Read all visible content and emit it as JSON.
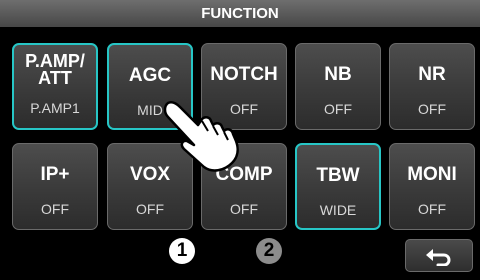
{
  "title": "FUNCTION",
  "buttons": [
    {
      "id": "pamp-att",
      "name": "P.AMP/\nATT",
      "value": "P.AMP1",
      "active": true
    },
    {
      "id": "agc",
      "name": "AGC",
      "value": "MID",
      "active": true
    },
    {
      "id": "notch",
      "name": "NOTCH",
      "value": "OFF",
      "active": false
    },
    {
      "id": "nb",
      "name": "NB",
      "value": "OFF",
      "active": false
    },
    {
      "id": "nr",
      "name": "NR",
      "value": "OFF",
      "active": false
    },
    {
      "id": "ip-plus",
      "name": "IP+",
      "value": "OFF",
      "active": false
    },
    {
      "id": "vox",
      "name": "VOX",
      "value": "OFF",
      "active": false
    },
    {
      "id": "comp",
      "name": "COMP",
      "value": "OFF",
      "active": false
    },
    {
      "id": "tbw",
      "name": "TBW",
      "value": "WIDE",
      "active": true
    },
    {
      "id": "moni",
      "name": "MONI",
      "value": "OFF",
      "active": false
    }
  ],
  "pages": {
    "page1": "1",
    "page2": "2"
  },
  "back_icon": "return-arrow-icon",
  "accent_color": "#27c6c6"
}
